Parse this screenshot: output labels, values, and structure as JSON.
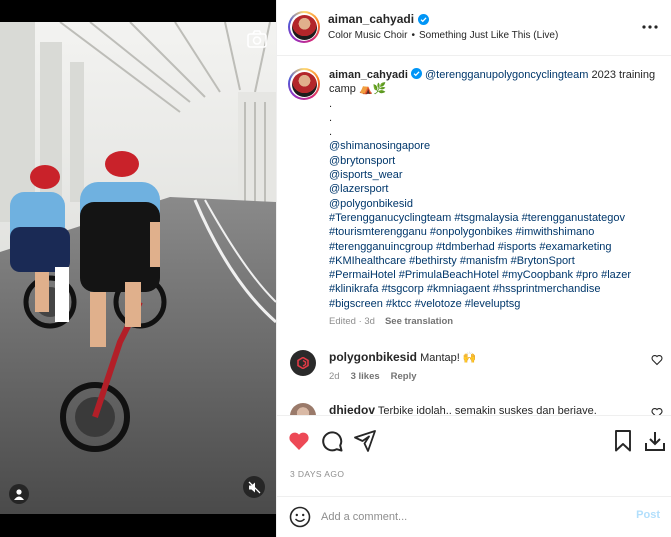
{
  "post": {
    "author": "aiman_cahyadi",
    "music": {
      "artist": "Color Music Choir",
      "separator": "•",
      "song": "Something Just Like This (Live)"
    }
  },
  "caption": {
    "username": "aiman_cahyadi",
    "mention_main": "@terengganupolygoncyclingteam",
    "text_after_mention": " 2023 training camp ",
    "emojis": "⛺🌿",
    "dots": [
      ".",
      ".",
      "."
    ],
    "mention_lines": [
      "@shimanosingapore",
      "@brytonsport",
      "@isports_wear",
      "@lazersport",
      "@polygonbikesid"
    ],
    "hashtag_lines": [
      "#Terengganucyclingteam #tsgmalaysia #terengganustategov",
      "#tourismterengganu #onpolygonbikes #imwithshimano",
      "#terengganuincgroup #tdmberhad #isports #examarketing",
      "#KMIhealthcare #bethirsty #manisfm #BrytonSport",
      "#PermaiHotel #PrimulaBeachHotel #myCoopbank #pro #lazer",
      "#klinikrafa #tsgcorp #kmniagaent #hssprintmerchandise",
      "#bigscreen #ktcc #velotoze #leveluptsg"
    ],
    "edited": "Edited · 3d",
    "see_translation": "See translation"
  },
  "comments": [
    {
      "username": "polygonbikesid",
      "text": "Mantap! 🙌",
      "time": "2d",
      "likes": "3 likes",
      "reply": "Reply"
    },
    {
      "username": "dhiedov",
      "text": "Terbike idolah.. semakin suskes dan beriave."
    }
  ],
  "actions": {
    "posted": "3 DAYS AGO"
  },
  "add_comment": {
    "placeholder": "Add a comment...",
    "post_label": "Post"
  },
  "icons": [
    "camera-icon",
    "user-tag-icon",
    "mute-icon",
    "verified-badge-icon",
    "more-options-icon",
    "heart-icon",
    "comment-icon",
    "share-icon",
    "bookmark-icon",
    "download-icon",
    "emoji-icon"
  ],
  "colors": {
    "heart_liked": "#ed4956",
    "link": "#00376b",
    "verified": "#0095f6",
    "post_disabled": "#b2dffc"
  }
}
